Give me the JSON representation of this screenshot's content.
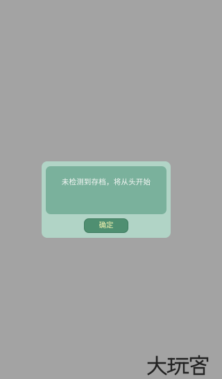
{
  "dialog": {
    "message": "未检测到存档，将从头开始",
    "confirm_label": "确定"
  },
  "watermark": {
    "text": "大玩客"
  },
  "colors": {
    "backdrop": "#a3a3a3",
    "dialog_bg": "#b1d4c6",
    "message_panel_bg": "#7ab19c",
    "button_bg": "#4f8f71",
    "button_text": "#f0f1b0"
  }
}
